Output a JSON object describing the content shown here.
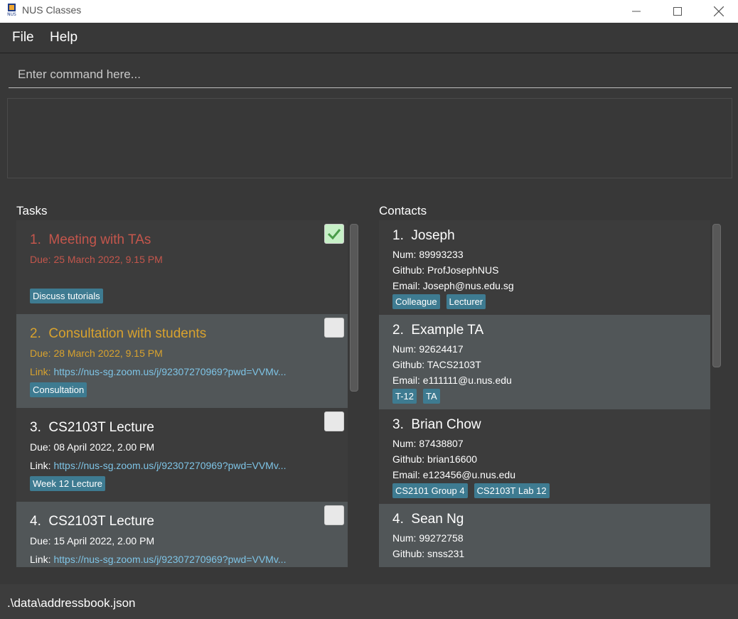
{
  "window": {
    "title": "NUS Classes",
    "icon": "nus-logo-icon"
  },
  "menu": {
    "file": "File",
    "help": "Help"
  },
  "command": {
    "placeholder": "Enter command here..."
  },
  "result": {
    "text": ""
  },
  "tasks": {
    "title": "Tasks",
    "items": [
      {
        "index": "1.",
        "name": "Meeting with TAs",
        "due": "Due: 25 March 2022, 9.15 PM",
        "link_label": "",
        "link": "",
        "tags": [
          "Discuss tutorials"
        ],
        "done": true,
        "color": "#c4564c"
      },
      {
        "index": "2.",
        "name": "Consultation with students",
        "due": "Due: 28 March 2022, 9.15 PM",
        "link_label": "Link:",
        "link": "https://nus-sg.zoom.us/j/92307270969?pwd=VVMv...",
        "tags": [
          "Consultation"
        ],
        "done": false,
        "color": "#d8a22e"
      },
      {
        "index": "3.",
        "name": "CS2103T Lecture",
        "due": "Due: 08 April 2022, 2.00 PM",
        "link_label": "Link:",
        "link": "https://nus-sg.zoom.us/j/92307270969?pwd=VVMv...",
        "tags": [
          "Week 12 Lecture"
        ],
        "done": false,
        "color": "#ffffff"
      },
      {
        "index": "4.",
        "name": "CS2103T Lecture",
        "due": "Due: 15 April 2022, 2.00 PM",
        "link_label": "Link:",
        "link": "https://nus-sg.zoom.us/j/92307270969?pwd=VVMv...",
        "tags": [],
        "done": false,
        "color": "#ffffff"
      }
    ]
  },
  "contacts": {
    "title": "Contacts",
    "items": [
      {
        "index": "1.",
        "name": "Joseph",
        "num": "Num: 89993233",
        "github": "Github: ProfJosephNUS",
        "email": "Email: Joseph@nus.edu.sg",
        "tags": [
          "Colleague",
          "Lecturer"
        ]
      },
      {
        "index": "2.",
        "name": "Example TA",
        "num": "Num: 92624417",
        "github": "Github: TACS2103T",
        "email": "Email: e111111@u.nus.edu",
        "tags": [
          "T-12",
          "TA"
        ]
      },
      {
        "index": "3.",
        "name": "Brian Chow",
        "num": "Num: 87438807",
        "github": "Github: brian16600",
        "email": "Email: e123456@u.nus.edu",
        "tags": [
          "CS2101 Group 4",
          "CS2103T Lab 12"
        ]
      },
      {
        "index": "4.",
        "name": "Sean Ng",
        "num": "Num: 99272758",
        "github": "Github: snss231",
        "email": "",
        "tags": []
      }
    ]
  },
  "status": {
    "path": ".\\data\\addressbook.json"
  }
}
